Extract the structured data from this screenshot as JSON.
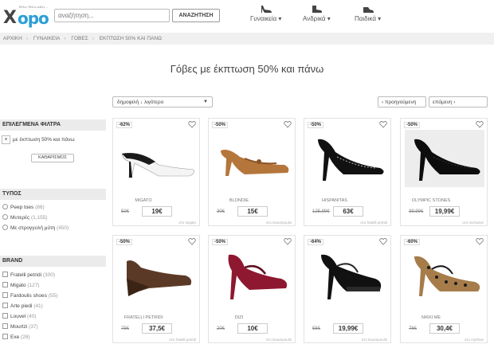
{
  "header": {
    "logo_text": "opo",
    "logo_mark": "X",
    "logo_tagline": "θέλω θέλω κάτι...",
    "search_placeholder": "αναζήτηση...",
    "search_button": "ΑΝΑΖΗΤΗΣΗ",
    "nav": [
      {
        "label": "Γυναικεία",
        "icon": "heel-shoe-icon"
      },
      {
        "label": "Ανδρικά",
        "icon": "boot-icon"
      },
      {
        "label": "Παιδικά",
        "icon": "sneaker-icon"
      }
    ]
  },
  "breadcrumb": [
    "ΑΡΧΙΚΗ",
    "ΓΥΝΑΙΚΕΙΑ",
    "ΓΟΒΕΣ",
    "ΕΚΠΤΩΣΗ 50% ΚΑΙ ΠΑΝΩ"
  ],
  "page_title": "Γόβες με έκπτωση 50% και πάνω",
  "sort": {
    "selected": "δημοφιλή ↓ λιγότερο"
  },
  "pager": {
    "prev": "‹ προηγούμενη",
    "next": "επόμενη ›"
  },
  "sidebar": {
    "active_filters_title": "ΕΠΙΛΕΓΜΕΝΑ ΦΙΛΤΡΑ",
    "active_filter": "με έκπτωση 50% και πάνω",
    "clear_button": "ΚΑΘΑΡΙΣΜΟΣ",
    "type_title": "ΤΥΠΟΣ",
    "types": [
      {
        "label": "Peep toes",
        "count": "(86)"
      },
      {
        "label": "Μυτερές",
        "count": "(1,155)"
      },
      {
        "label": "Με στρογγυλή μύτη",
        "count": "(450)"
      }
    ],
    "brand_title": "BRAND",
    "brands": [
      {
        "label": "Fratelli petridi",
        "count": "(300)"
      },
      {
        "label": "Migato",
        "count": "(127)"
      },
      {
        "label": "Fardoulis shoes",
        "count": "(55)"
      },
      {
        "label": "Arte piedi",
        "count": "(41)"
      },
      {
        "label": "Louvel",
        "count": "(40)"
      },
      {
        "label": "Mourtzi",
        "count": "(37)"
      },
      {
        "label": "Exe",
        "count": "(28)"
      }
    ]
  },
  "products": [
    {
      "discount": "-62%",
      "brand": "MIGATO",
      "old_price": "50€",
      "price": "19€",
      "shop": "στο migato",
      "style": "slingback",
      "color": "#1a1a1a",
      "accent": "#f4f4f4"
    },
    {
      "discount": "-50%",
      "brand": "BLONDIE",
      "old_price": "30€",
      "price": "15€",
      "shop": "στο tsoumpoulis",
      "style": "pump",
      "color": "#b5763c",
      "accent": "#8a5224"
    },
    {
      "discount": "-50%",
      "brand": "HISPANITAS",
      "old_price": "125,99€",
      "price": "63€",
      "shop": "στο fratelli petridi",
      "style": "stiletto",
      "color": "#111111",
      "accent": "#bbbbbb"
    },
    {
      "discount": "-50%",
      "brand": "OLYMPIC STONES",
      "old_price": "39,99€",
      "price": "19,99€",
      "shop": "στο exclusive",
      "style": "stiletto",
      "color": "#0d0d0d",
      "accent": "#333333"
    },
    {
      "discount": "-50%",
      "brand": "FRATELLI PETRIDI",
      "old_price": "75€",
      "price": "37,5€",
      "shop": "στο fratelli petridi",
      "style": "wedge",
      "color": "#5a3a26",
      "accent": "#3b2416"
    },
    {
      "discount": "-50%",
      "brand": "DIZI",
      "old_price": "20€",
      "price": "10€",
      "shop": "στο tsoumpoulis",
      "style": "maryjane",
      "color": "#8e1830",
      "accent": "#5c0f1f"
    },
    {
      "discount": "-64%",
      "brand": "",
      "old_price": "55€",
      "price": "19,99€",
      "shop": "στο tsoumpoulis",
      "style": "platform",
      "color": "#111111",
      "accent": "#2a2a2a"
    },
    {
      "discount": "-60%",
      "brand": "NIKKI ME",
      "old_price": "76€",
      "price": "30,4€",
      "shop": "στο myshoe",
      "style": "leopard",
      "color": "#a67c4a",
      "accent": "#1b1b1b"
    }
  ]
}
